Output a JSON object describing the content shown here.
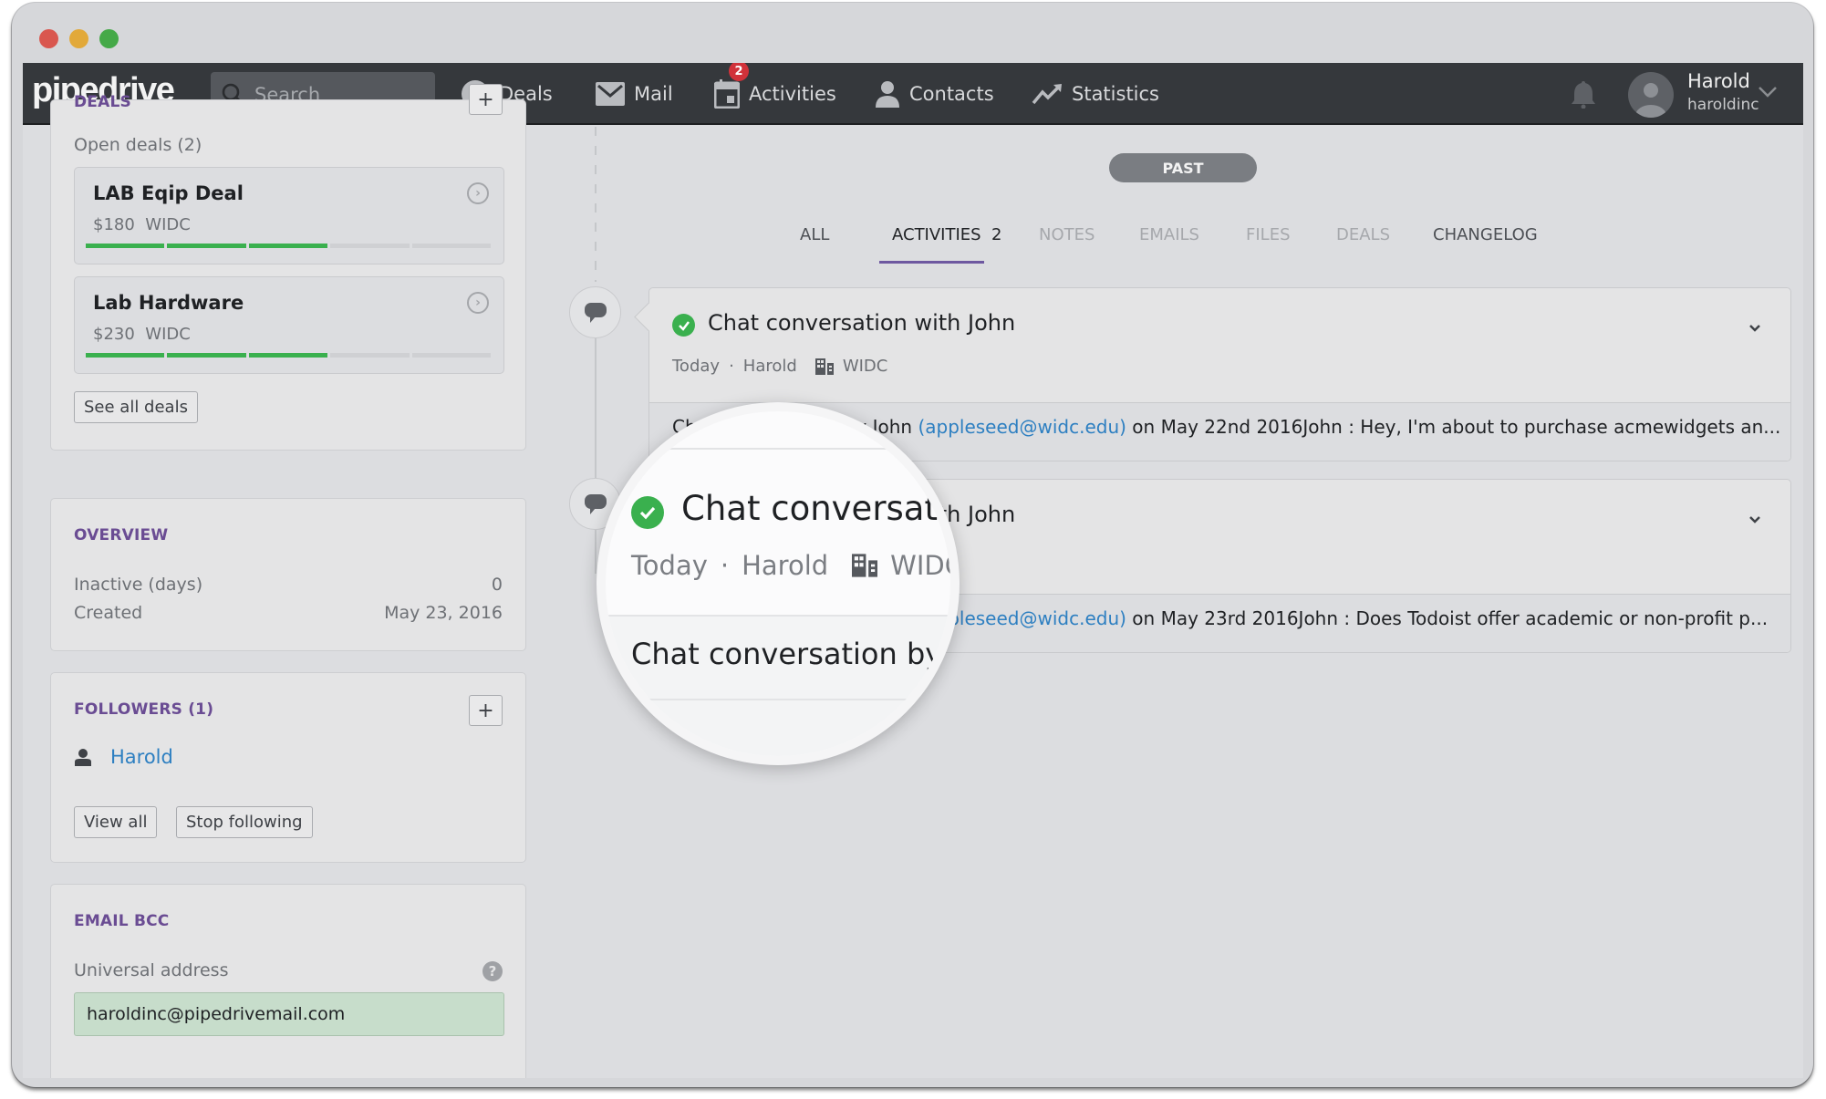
{
  "header": {
    "logo": "pipedrive",
    "search_placeholder": "Search",
    "nav": [
      {
        "label": "Deals",
        "icon": "dollar-icon"
      },
      {
        "label": "Mail",
        "icon": "mail-icon"
      },
      {
        "label": "Activities",
        "icon": "calendar-icon",
        "badge": "2"
      },
      {
        "label": "Contacts",
        "icon": "person-icon"
      },
      {
        "label": "Statistics",
        "icon": "trend-icon"
      }
    ],
    "user": {
      "name": "Harold",
      "company": "haroldinc"
    }
  },
  "sidebar": {
    "deals": {
      "title": "DEALS",
      "open_label": "Open deals (2)",
      "items": [
        {
          "title": "LAB Eqip Deal",
          "value": "$180",
          "org": "WIDC",
          "stages_total": 5,
          "stages_done": 3
        },
        {
          "title": "Lab Hardware",
          "value": "$230",
          "org": "WIDC",
          "stages_total": 5,
          "stages_done": 3
        }
      ],
      "see_all_label": "See all deals"
    },
    "overview": {
      "title": "OVERVIEW",
      "rows": [
        {
          "label": "Inactive (days)",
          "value": "0"
        },
        {
          "label": "Created",
          "value": "May 23, 2016"
        }
      ]
    },
    "followers": {
      "title": "FOLLOWERS (1)",
      "items": [
        {
          "name": "Harold"
        }
      ],
      "view_all_label": "View all",
      "stop_following_label": "Stop following"
    },
    "email_bcc": {
      "title": "EMAIL BCC",
      "label": "Universal address",
      "value": "haroldinc@pipedrivemail.com"
    }
  },
  "main": {
    "period_label": "PAST",
    "tabs": [
      {
        "label": "ALL",
        "state": "normal"
      },
      {
        "label": "ACTIVITIES  2",
        "state": "active"
      },
      {
        "label": "NOTES",
        "state": "disabled"
      },
      {
        "label": "EMAILS",
        "state": "disabled"
      },
      {
        "label": "FILES",
        "state": "disabled"
      },
      {
        "label": "DEALS",
        "state": "disabled"
      },
      {
        "label": "CHANGELOG",
        "state": "normal"
      }
    ],
    "activities": [
      {
        "title": "Chat conversation with John",
        "date": "Today",
        "owner": "Harold",
        "org": "WIDC",
        "body_prefix": "Chat conversation by John ",
        "email": "(appleseed@widc.edu)",
        "body_suffix": " on May 22nd 2016John : Hey, I'm about to purchase acmewidgets an..."
      },
      {
        "title": "Chat conversation with John",
        "date": "Today",
        "owner": "Harold",
        "org": "WIDC",
        "body_prefix": "Chat conversation by John ",
        "email": "(appleseed@widc.edu)",
        "body_suffix": " on May 23rd 2016John : Does Todoist offer academic or non-profit p..."
      }
    ],
    "magnifier": {
      "title": "Chat conversatio",
      "date": "Today",
      "owner": "Harold",
      "org": "WIDC",
      "body": "Chat conversation by Jo"
    }
  },
  "colors": {
    "accent_purple": "#6a4c93",
    "success_green": "#3ab04e",
    "link_blue": "#2d7fc1",
    "badge_red": "#d1323a",
    "header_bg": "#35383c"
  }
}
